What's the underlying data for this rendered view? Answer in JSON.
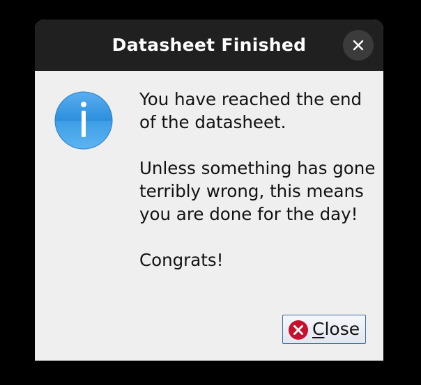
{
  "window": {
    "title": "Datasheet Finished",
    "close_icon": "close-icon"
  },
  "message": {
    "icon": "info-icon",
    "paragraphs": [
      "You have reached the end of the datasheet.",
      "Unless something has gone terribly wrong, this means you are done for the day!",
      "Congrats!"
    ]
  },
  "buttons": {
    "close": {
      "icon": "close-circle-icon",
      "mnemonic": "C",
      "label_rest": "lose"
    }
  },
  "colors": {
    "titlebar": "#202020",
    "dialog_background": "#efefef",
    "info_blue": "#3d9be3",
    "close_red": "#c8102e"
  }
}
